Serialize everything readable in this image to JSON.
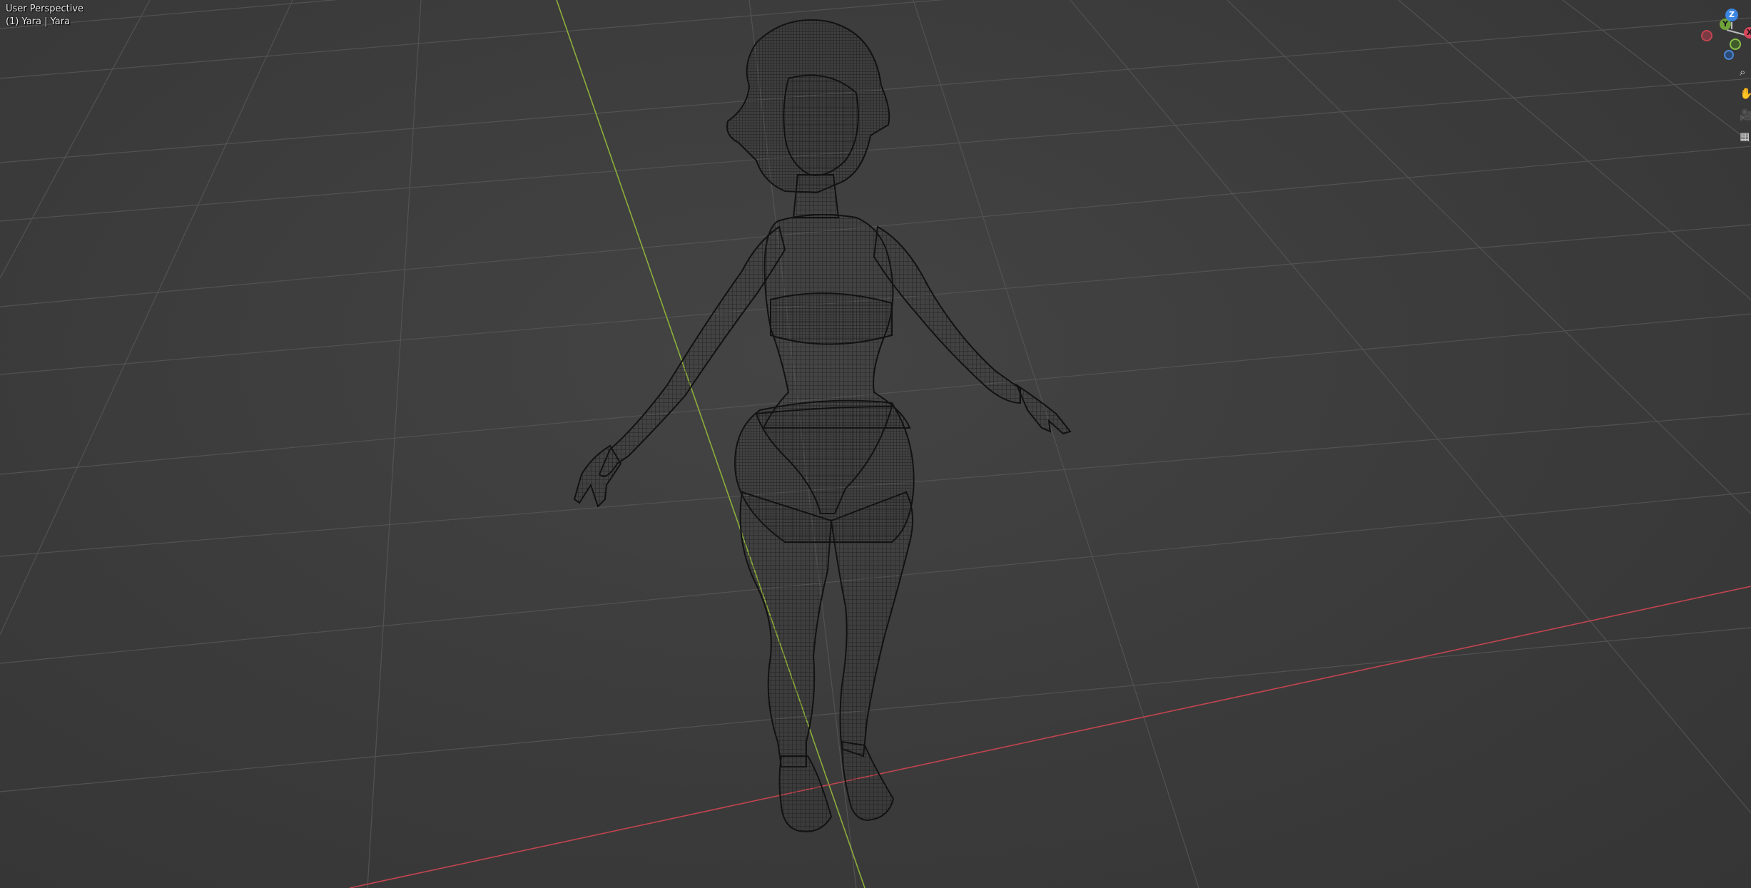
{
  "viewport": {
    "view_name": "User Perspective",
    "object_info": "(1) Yara | Yara",
    "colors": {
      "background": "#3d3d3d",
      "grid": "#555555",
      "x_axis": "#c2444f",
      "y_axis": "#8cae3a",
      "wireframe": "#141414"
    }
  },
  "gizmo": {
    "z_label": "Z",
    "y_label": "Y",
    "x_label": "X",
    "colors": {
      "x": "#d8455a",
      "y": "#6fa33a",
      "z": "#3b84e0"
    }
  },
  "tools": [
    {
      "name": "zoom-icon",
      "glyph": "⌕"
    },
    {
      "name": "hand-pan-icon",
      "glyph": "✋"
    },
    {
      "name": "camera-icon",
      "glyph": "🎥"
    },
    {
      "name": "grid-toggle-icon",
      "glyph": "▦"
    }
  ]
}
